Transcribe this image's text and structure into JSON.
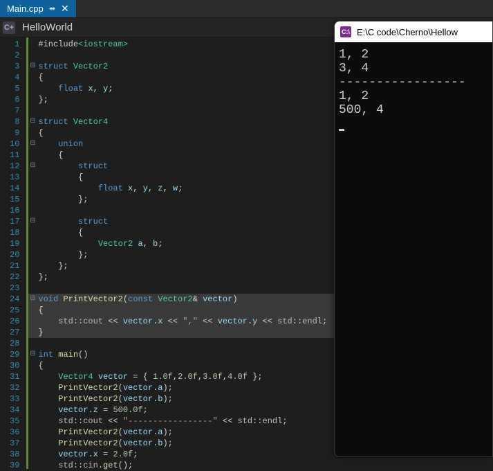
{
  "tab": {
    "filename": "Main.cpp",
    "pin": "⇴",
    "close": "✕"
  },
  "nav": {
    "icon": "C+",
    "scope": "HelloWorld",
    "dropdown": "▾"
  },
  "console": {
    "icon": "C:\\",
    "title": "E:\\C code\\Cherno\\Hellow",
    "lines": [
      "1, 2",
      "3, 4",
      "-----------------",
      "1, 2",
      "500, 4"
    ]
  },
  "gutter_start": 1,
  "gutter_end": 39,
  "code_lines": [
    {
      "fold": "",
      "spans": [
        [
          "pn",
          "#include"
        ],
        [
          "typ",
          "<iostream>"
        ]
      ]
    },
    {
      "fold": "",
      "spans": []
    },
    {
      "fold": "⊟",
      "spans": [
        [
          "kw",
          "struct "
        ],
        [
          "typ",
          "Vector2"
        ]
      ]
    },
    {
      "fold": "",
      "spans": [
        [
          "pn",
          "{"
        ]
      ]
    },
    {
      "fold": "",
      "spans": [
        [
          "pn",
          "    "
        ],
        [
          "kw",
          "float "
        ],
        [
          "var",
          "x"
        ],
        [
          "pn",
          ", "
        ],
        [
          "var",
          "y"
        ],
        [
          "pn",
          ";"
        ]
      ]
    },
    {
      "fold": "",
      "spans": [
        [
          "pn",
          "};"
        ]
      ]
    },
    {
      "fold": "",
      "spans": []
    },
    {
      "fold": "⊟",
      "spans": [
        [
          "kw",
          "struct "
        ],
        [
          "typ",
          "Vector4"
        ]
      ]
    },
    {
      "fold": "",
      "spans": [
        [
          "pn",
          "{"
        ]
      ]
    },
    {
      "fold": "⊟",
      "spans": [
        [
          "pn",
          "    "
        ],
        [
          "kw",
          "union"
        ]
      ]
    },
    {
      "fold": "",
      "spans": [
        [
          "pn",
          "    {"
        ]
      ]
    },
    {
      "fold": "⊟",
      "spans": [
        [
          "pn",
          "        "
        ],
        [
          "kw",
          "struct"
        ]
      ]
    },
    {
      "fold": "",
      "spans": [
        [
          "pn",
          "        {"
        ]
      ]
    },
    {
      "fold": "",
      "spans": [
        [
          "pn",
          "            "
        ],
        [
          "kw",
          "float "
        ],
        [
          "var",
          "x"
        ],
        [
          "pn",
          ", "
        ],
        [
          "var",
          "y"
        ],
        [
          "pn",
          ", "
        ],
        [
          "var",
          "z"
        ],
        [
          "pn",
          ", "
        ],
        [
          "var",
          "w"
        ],
        [
          "pn",
          ";"
        ]
      ]
    },
    {
      "fold": "",
      "spans": [
        [
          "pn",
          "        };"
        ]
      ]
    },
    {
      "fold": "",
      "spans": []
    },
    {
      "fold": "⊟",
      "spans": [
        [
          "pn",
          "        "
        ],
        [
          "kw",
          "struct"
        ]
      ]
    },
    {
      "fold": "",
      "spans": [
        [
          "pn",
          "        {"
        ]
      ]
    },
    {
      "fold": "",
      "spans": [
        [
          "pn",
          "            "
        ],
        [
          "typ",
          "Vector2 "
        ],
        [
          "var",
          "a"
        ],
        [
          "pn",
          ", "
        ],
        [
          "var",
          "b"
        ],
        [
          "pn",
          ";"
        ]
      ]
    },
    {
      "fold": "",
      "spans": [
        [
          "pn",
          "        };"
        ]
      ]
    },
    {
      "fold": "",
      "spans": [
        [
          "pn",
          "    };"
        ]
      ]
    },
    {
      "fold": "",
      "spans": [
        [
          "pn",
          "};"
        ]
      ]
    },
    {
      "fold": "",
      "spans": []
    },
    {
      "fold": "⊟",
      "hl": true,
      "spans": [
        [
          "kw",
          "void "
        ],
        [
          "fn",
          "PrintVector2"
        ],
        [
          "pn",
          "("
        ],
        [
          "kw",
          "const "
        ],
        [
          "typ",
          "Vector2"
        ],
        [
          "pn",
          "& "
        ],
        [
          "var",
          "vector"
        ],
        [
          "pn",
          ")"
        ]
      ]
    },
    {
      "fold": "",
      "hl": true,
      "spans": [
        [
          "pn",
          "{"
        ]
      ]
    },
    {
      "fold": "",
      "hl": true,
      "spans": [
        [
          "pn",
          "    "
        ],
        [
          "glob",
          "std"
        ],
        [
          "pn",
          "::"
        ],
        [
          "glob",
          "cout"
        ],
        [
          "pn",
          " << "
        ],
        [
          "var",
          "vector"
        ],
        [
          "pn",
          "."
        ],
        [
          "var",
          "x"
        ],
        [
          "pn",
          " << "
        ],
        [
          "str",
          "\",\""
        ],
        [
          "pn",
          " << "
        ],
        [
          "var",
          "vector"
        ],
        [
          "pn",
          "."
        ],
        [
          "var",
          "y"
        ],
        [
          "pn",
          " << "
        ],
        [
          "glob",
          "std"
        ],
        [
          "pn",
          "::"
        ],
        [
          "glob",
          "endl"
        ],
        [
          "pn",
          ";"
        ]
      ]
    },
    {
      "fold": "",
      "hl": true,
      "spans": [
        [
          "pn",
          "}"
        ]
      ]
    },
    {
      "fold": "",
      "spans": []
    },
    {
      "fold": "⊟",
      "spans": [
        [
          "kw",
          "int "
        ],
        [
          "fn",
          "main"
        ],
        [
          "pn",
          "()"
        ]
      ]
    },
    {
      "fold": "",
      "spans": [
        [
          "pn",
          "{"
        ]
      ]
    },
    {
      "fold": "",
      "spans": [
        [
          "pn",
          "    "
        ],
        [
          "typ",
          "Vector4 "
        ],
        [
          "var",
          "vector"
        ],
        [
          "pn",
          " = { "
        ],
        [
          "num",
          "1.0f"
        ],
        [
          "pn",
          ","
        ],
        [
          "num",
          "2.0f"
        ],
        [
          "pn",
          ","
        ],
        [
          "num",
          "3.0f"
        ],
        [
          "pn",
          ","
        ],
        [
          "num",
          "4.0f"
        ],
        [
          "pn",
          " };"
        ]
      ]
    },
    {
      "fold": "",
      "spans": [
        [
          "pn",
          "    "
        ],
        [
          "fn",
          "PrintVector2"
        ],
        [
          "pn",
          "("
        ],
        [
          "var",
          "vector"
        ],
        [
          "pn",
          "."
        ],
        [
          "var",
          "a"
        ],
        [
          "pn",
          ");"
        ]
      ]
    },
    {
      "fold": "",
      "spans": [
        [
          "pn",
          "    "
        ],
        [
          "fn",
          "PrintVector2"
        ],
        [
          "pn",
          "("
        ],
        [
          "var",
          "vector"
        ],
        [
          "pn",
          "."
        ],
        [
          "var",
          "b"
        ],
        [
          "pn",
          ");"
        ]
      ]
    },
    {
      "fold": "",
      "spans": [
        [
          "pn",
          "    "
        ],
        [
          "var",
          "vector"
        ],
        [
          "pn",
          "."
        ],
        [
          "var",
          "z"
        ],
        [
          "pn",
          " = "
        ],
        [
          "num",
          "500.0f"
        ],
        [
          "pn",
          ";"
        ]
      ]
    },
    {
      "fold": "",
      "spans": [
        [
          "pn",
          "    "
        ],
        [
          "glob",
          "std"
        ],
        [
          "pn",
          "::"
        ],
        [
          "glob",
          "cout"
        ],
        [
          "pn",
          " << "
        ],
        [
          "str",
          "\"-----------------\""
        ],
        [
          "pn",
          " << "
        ],
        [
          "glob",
          "std"
        ],
        [
          "pn",
          "::"
        ],
        [
          "glob",
          "endl"
        ],
        [
          "pn",
          ";"
        ]
      ]
    },
    {
      "fold": "",
      "spans": [
        [
          "pn",
          "    "
        ],
        [
          "fn",
          "PrintVector2"
        ],
        [
          "pn",
          "("
        ],
        [
          "var",
          "vector"
        ],
        [
          "pn",
          "."
        ],
        [
          "var",
          "a"
        ],
        [
          "pn",
          ");"
        ]
      ]
    },
    {
      "fold": "",
      "spans": [
        [
          "pn",
          "    "
        ],
        [
          "fn",
          "PrintVector2"
        ],
        [
          "pn",
          "("
        ],
        [
          "var",
          "vector"
        ],
        [
          "pn",
          "."
        ],
        [
          "var",
          "b"
        ],
        [
          "pn",
          ");"
        ]
      ]
    },
    {
      "fold": "",
      "spans": [
        [
          "pn",
          "    "
        ],
        [
          "var",
          "vector"
        ],
        [
          "pn",
          "."
        ],
        [
          "var",
          "x"
        ],
        [
          "pn",
          " = "
        ],
        [
          "num",
          "2.0f"
        ],
        [
          "pn",
          ";"
        ]
      ]
    },
    {
      "fold": "",
      "spans": [
        [
          "pn",
          "    "
        ],
        [
          "glob",
          "std"
        ],
        [
          "pn",
          "::"
        ],
        [
          "glob",
          "cin"
        ],
        [
          "pn",
          "."
        ],
        [
          "fn",
          "get"
        ],
        [
          "pn",
          "();"
        ]
      ]
    }
  ]
}
